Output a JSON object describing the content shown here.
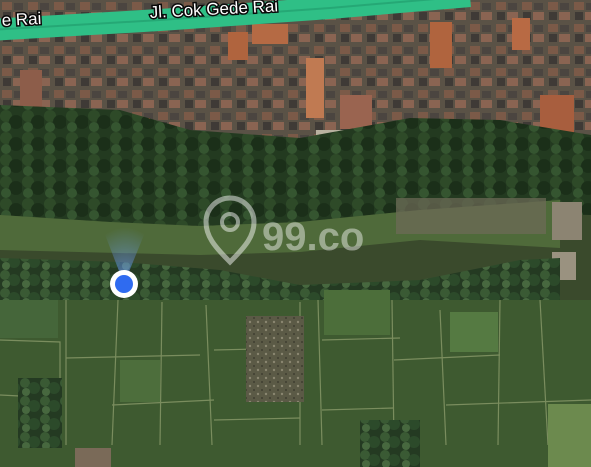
{
  "map": {
    "type": "satellite",
    "road": {
      "name_left": "e Rai",
      "name_main": "Jl. Cok Gede Rai",
      "color": "#2fbf86"
    },
    "location_marker": {
      "color": "#2f6bf0",
      "beam_color": "#6ea0ff"
    },
    "watermark": {
      "text": "99.co",
      "icon": "map-pin-icon"
    }
  }
}
